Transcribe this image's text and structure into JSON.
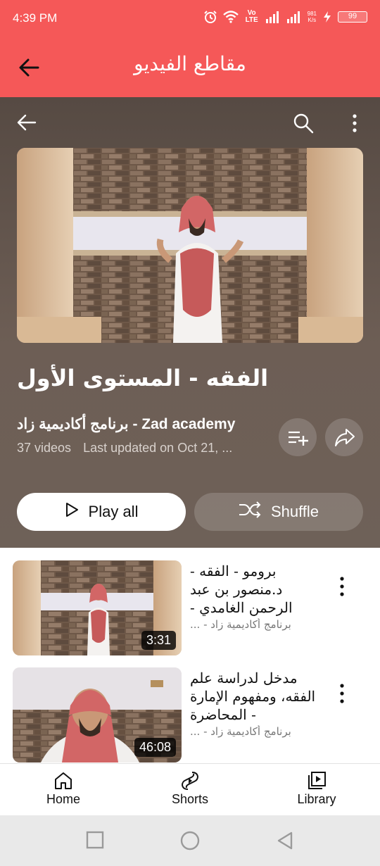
{
  "status_bar": {
    "time": "4:39 PM",
    "net_speed_value": "981",
    "net_speed_unit": "K/s",
    "battery": "99",
    "icons": [
      "alarm-icon",
      "wifi-icon",
      "volte-icon",
      "signal-icon",
      "signal-icon",
      "charging-icon",
      "battery-icon"
    ],
    "volte_label": "Vo LTE"
  },
  "app_bar": {
    "title": "مقاطع الفيديو",
    "back_icon": "arrow-left-icon"
  },
  "colors": {
    "accent": "#f55858",
    "hero_background": "#5e524b",
    "text_dark": "#111111"
  },
  "playlist": {
    "title": "الفقه - المستوى الأول",
    "channel": "برنامج أكاديمية زاد - Zad academy",
    "video_count": "37 videos",
    "last_updated": "Last updated on Oct 21, ...",
    "play_all_label": "Play all",
    "shuffle_label": "Shuffle",
    "icons": {
      "back": "arrow-left-icon",
      "search": "search-icon",
      "more": "more-vertical-icon",
      "save": "add-to-queue-icon",
      "share": "share-icon"
    }
  },
  "videos": [
    {
      "title": "برومو - الفقه - د.منصور بن عبد الرحمن الغامدي -",
      "channel": "برنامج أكاديمية زاد - ...",
      "duration": "3:31"
    },
    {
      "title": "مدخل لدراسة علم الفقه، ومفهوم الإمارة - المحاضرة",
      "channel": "برنامج أكاديمية زاد - ...",
      "duration": "46:08"
    }
  ],
  "bottom_nav": [
    {
      "label": "Home",
      "icon": "home-icon"
    },
    {
      "label": "Shorts",
      "icon": "shorts-icon"
    },
    {
      "label": "Library",
      "icon": "library-icon"
    }
  ],
  "system_nav": [
    "recents-icon",
    "home-circle-icon",
    "back-triangle-icon"
  ]
}
